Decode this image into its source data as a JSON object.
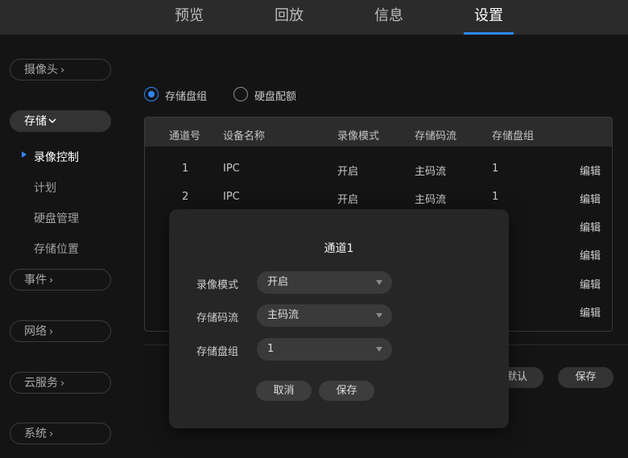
{
  "top_nav": {
    "tabs": [
      {
        "label": "预览"
      },
      {
        "label": "回放"
      },
      {
        "label": "信息"
      },
      {
        "label": "设置",
        "active": true
      }
    ]
  },
  "sidebar": {
    "camera": "摄像头",
    "storage": "存储",
    "storage_items": [
      "录像控制",
      "计划",
      "硬盘管理",
      "存储位置"
    ],
    "event": "事件",
    "network": "网络",
    "cloud": "云服务",
    "system": "系统",
    "chevron_right": "›",
    "chevron_down": "⌄"
  },
  "storage_mode": {
    "options": [
      "存储盘组",
      "硬盘配额"
    ],
    "selected": "存储盘组"
  },
  "table": {
    "headers": [
      "通道号",
      "设备名称",
      "录像模式",
      "存储码流",
      "存储盘组"
    ],
    "rows": [
      {
        "channel": "1",
        "name": "IPC",
        "mode": "开启",
        "stream": "主码流",
        "group": "1",
        "action": "编辑"
      },
      {
        "channel": "2",
        "name": "IPC",
        "mode": "开启",
        "stream": "主码流",
        "group": "1",
        "action": "编辑"
      },
      {
        "action": "编辑"
      },
      {
        "action": "编辑"
      },
      {
        "action": "编辑"
      },
      {
        "action": "编辑"
      }
    ]
  },
  "bottom_buttons": {
    "default_partial": "默认",
    "save": "保存"
  },
  "modal": {
    "title": "通道1",
    "fields": [
      {
        "label": "录像模式",
        "value": "开启"
      },
      {
        "label": "存储码流",
        "value": "主码流"
      },
      {
        "label": "存储盘组",
        "value": "1"
      }
    ],
    "cancel": "取消",
    "save": "保存"
  },
  "colors": {
    "accent": "#2f86f6",
    "background": "#141414",
    "topbar": "#2b2b2b",
    "modal": "#262626"
  }
}
